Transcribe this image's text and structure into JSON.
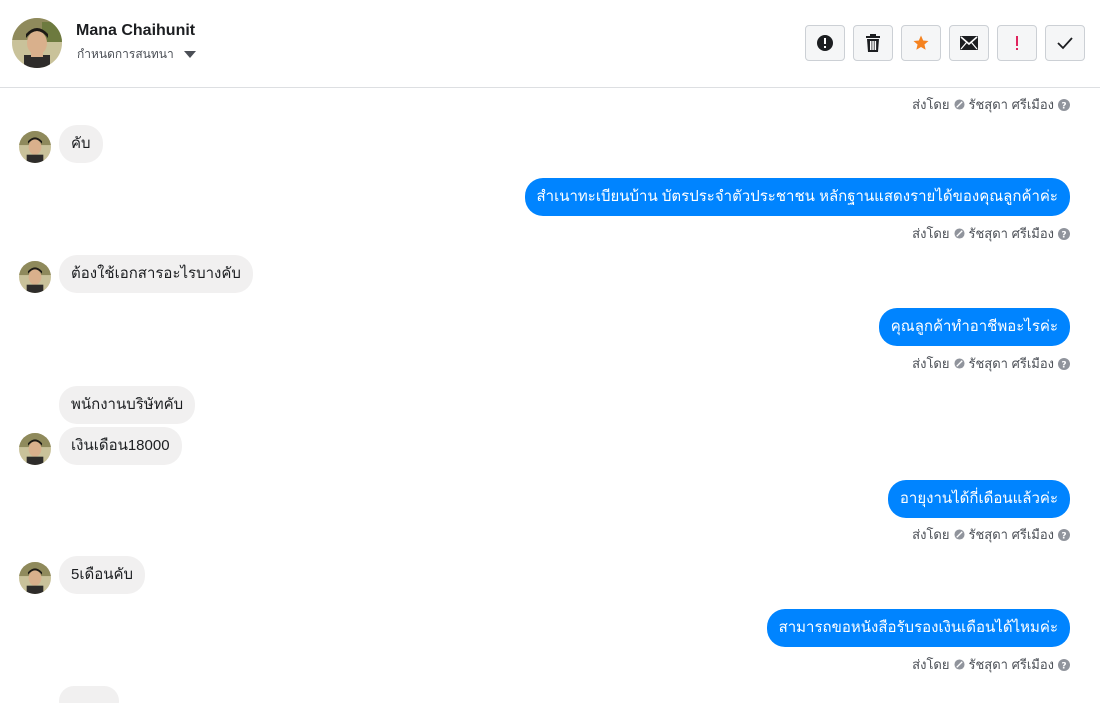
{
  "header": {
    "contact_name": "Mana Chaihunit",
    "subtitle": "กำหนดการสนทนา"
  },
  "actions": [
    {
      "name": "mark-spam-button",
      "icon": "exclamation-circle-icon"
    },
    {
      "name": "delete-button",
      "icon": "trash-icon"
    },
    {
      "name": "star-button",
      "icon": "star-icon",
      "color": "#f5821f"
    },
    {
      "name": "mark-unread-button",
      "icon": "envelope-icon"
    },
    {
      "name": "follow-up-button",
      "icon": "exclamation-icon",
      "color": "#e0245e"
    },
    {
      "name": "mark-done-button",
      "icon": "checkmark-icon"
    }
  ],
  "meta": {
    "sent_by": "ส่งโดย",
    "sender": "รัชสุดา ศรีเมือง"
  },
  "messages": [
    {
      "direction": "in",
      "text": "คับ"
    },
    {
      "direction": "out",
      "text": "สำเนาทะเบียนบ้าน บัตรประจำตัวประชาชน หลักฐานแสดงรายได้ของคุณลูกค้าค่ะ"
    },
    {
      "direction": "in",
      "text": "ต้องใช้เอกสารอะไรบางคับ"
    },
    {
      "direction": "out",
      "text": "คุณลูกค้าทำอาชีพอะไรค่ะ"
    },
    {
      "direction": "in",
      "text": "พนักงานบริษัทคับ"
    },
    {
      "direction": "in",
      "text": "เงินเดือน18000"
    },
    {
      "direction": "out",
      "text": "อายุงานได้กี่เดือนแล้วค่ะ"
    },
    {
      "direction": "in",
      "text": "5เดือนคับ"
    },
    {
      "direction": "out",
      "text": "สามารถขอหนังสือรับรองเงินเดือนได้ไหมค่ะ"
    }
  ],
  "colors": {
    "outgoing_bubble": "#0084ff",
    "incoming_bubble": "#f1f0f0"
  }
}
